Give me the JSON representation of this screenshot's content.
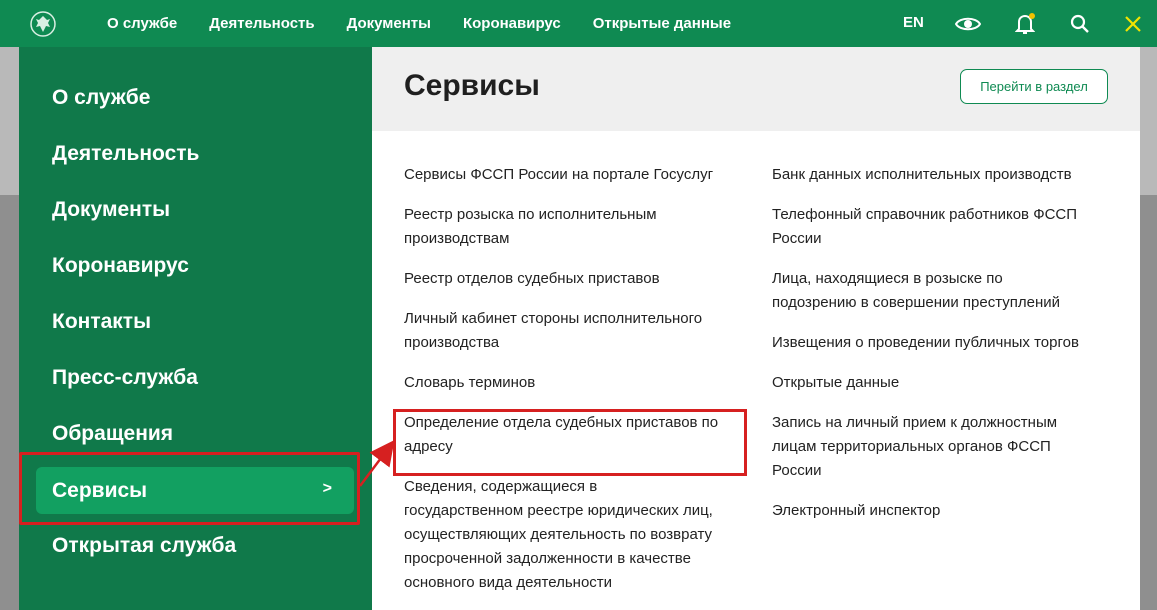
{
  "topbar": {
    "nav": [
      "О службе",
      "Деятельность",
      "Документы",
      "Коронавирус",
      "Открытые данные"
    ],
    "lang": "EN",
    "icons": [
      "eye-icon",
      "bell-icon",
      "search-icon",
      "close-icon"
    ],
    "notification_dot_color": "#f2c200"
  },
  "left_menu": {
    "items": [
      "О службе",
      "Деятельность",
      "Документы",
      "Коронавирус",
      "Контакты",
      "Пресс-служба",
      "Обращения"
    ],
    "active": {
      "label": "Сервисы",
      "chevron": ">"
    },
    "after": "Открытая служба"
  },
  "services": {
    "title": "Сервисы",
    "go_button": "Перейти в раздел",
    "col1": [
      "Сервисы ФССП России на портале Госуслуг",
      "Реестр розыска по исполнительным\nпроизводствам",
      "Реестр отделов судебных приставов",
      "Личный кабинет стороны исполнительного\nпроизводства",
      "Словарь терминов",
      "Определение отдела судебных приставов по\nадресу",
      "Сведения, содержащиеся в\nгосударственном реестре юридических лиц,\nосуществляющих деятельность по возврату\nпросроченной задолженности в качестве\nосновного вида деятельности"
    ],
    "col2": [
      "Банк данных исполнительных производств",
      "Телефонный справочник работников ФССП\nРоссии",
      "Лица, находящиеся в розыске по\nподозрению в совершении преступлений",
      "Извещения о проведении публичных торгов",
      "Открытые данные",
      "Запись на личный прием к должностным\nлицам территориальных органов ФССП\nРоссии",
      "Электронный инспектор"
    ]
  },
  "colors": {
    "brand_green": "#0f8a52",
    "highlight_red": "#d62020"
  }
}
